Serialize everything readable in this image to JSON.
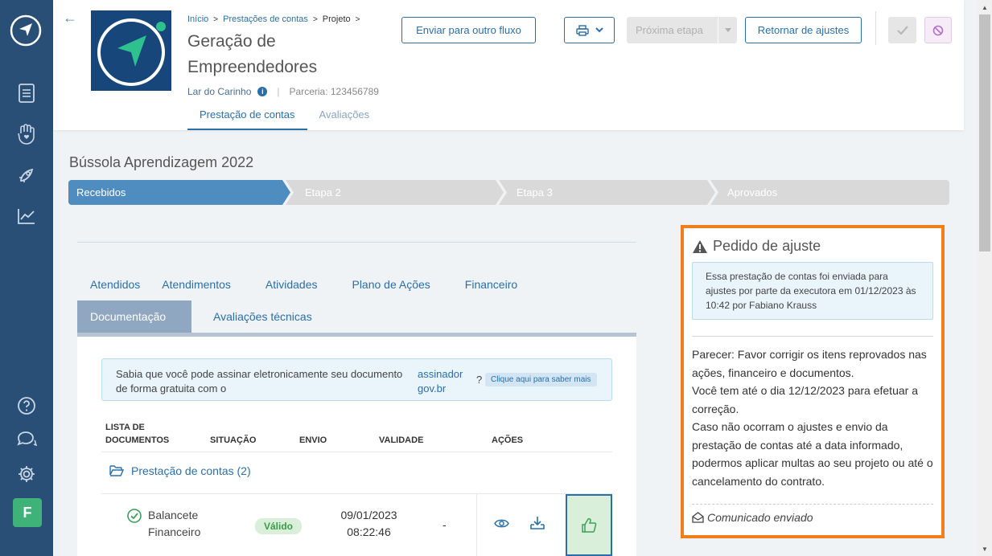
{
  "sidebar": {
    "logo_icon": "compass-arrow-logo",
    "nav_icons": [
      "document-list-icon",
      "hand-heart-icon",
      "rocket-icon",
      "chart-line-icon"
    ],
    "bottom_icons": [
      "help-icon",
      "chat-icon",
      "gear-icon"
    ],
    "avatar_initial": "F",
    "avatar_color": "#3fb27a"
  },
  "header": {
    "breadcrumb": [
      "Início",
      "Prestações de contas",
      "Projeto"
    ],
    "title": "Geração de Empreendedores",
    "org_name": "Lar do Carinho",
    "parceria": "Parceria: 123456789",
    "tabs": [
      {
        "label": "Prestação de contas",
        "active": true
      },
      {
        "label": "Avaliações",
        "active": false
      }
    ],
    "buttons": {
      "enviar": "Enviar para outro fluxo",
      "proxima": "Próxima etapa",
      "retornar": "Retornar de ajustes"
    }
  },
  "main": {
    "title": "Bússola Aprendizagem 2022",
    "steps": [
      {
        "label": "Recebidos",
        "active": true
      },
      {
        "label": "Etapa 2",
        "active": false
      },
      {
        "label": "Etapa 3",
        "active": false
      },
      {
        "label": "Aprovados",
        "active": false
      }
    ],
    "tabs_row1": [
      "Atendidos",
      "Atendimentos",
      "Atividades",
      "Plano de Ações",
      "Financeiro"
    ],
    "tabs_row2": [
      {
        "label": "Documentação",
        "active": true
      },
      {
        "label": "Avaliações técnicas",
        "active": false
      }
    ],
    "notice": {
      "text": "Sabia que você pode assinar eletronicamente seu documento de forma gratuita com o",
      "link": "assinador gov.br",
      "question": "?",
      "chip": "Clique aqui para saber mais"
    },
    "table": {
      "headers": [
        "LISTA DE DOCUMENTOS",
        "SITUAÇÃO",
        "ENVIO",
        "VALIDADE",
        "AÇÕES"
      ],
      "folder": "Prestação de contas (2)",
      "rows": [
        {
          "name": "Balancete Financeiro",
          "status": "Válido",
          "envio_date": "09/01/2023",
          "envio_time": "08:22:46",
          "validade": "-"
        }
      ]
    }
  },
  "side": {
    "title": "Pedido de ajuste",
    "info": "Essa prestação de contas foi enviada para ajustes por parte da executora em 01/12/2023 às 10:42 por Fabiano Krauss",
    "parecer": "Parecer: Favor corrigir os itens reprovados nas ações, financeiro e documentos.",
    "deadline": "Você tem até o dia 12/12/2023 para efetuar a correção.",
    "warning": "Caso não ocorram o ajustes e envio da prestação de contas até a data informado, podermos aplicar multas ao seu projeto ou até o cancelamento do contrato.",
    "footer": "Comunicado enviado",
    "border_color": "#f07f1c"
  },
  "colors": {
    "sidebar": "#2a4f77",
    "primary": "#2a6fa8",
    "step_active": "#4f8cc0",
    "step_inactive": "#d9d9d9"
  }
}
